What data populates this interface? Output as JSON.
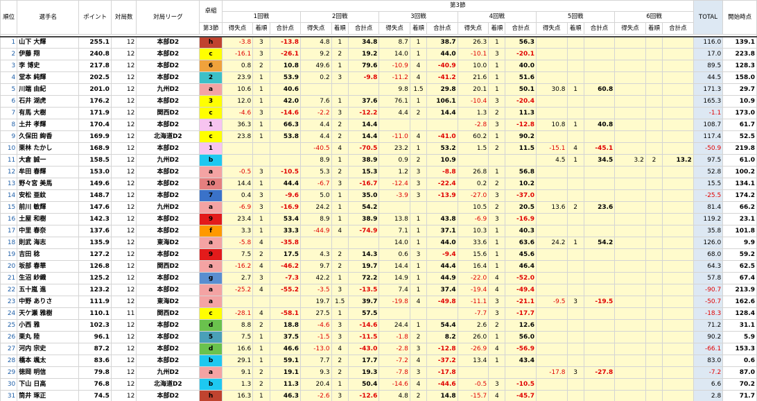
{
  "header": {
    "rank": "順位",
    "name": "選手名",
    "points": "ポイント",
    "games": "対局数",
    "league": "対局リーグ",
    "table_group": "卓組",
    "table_group_sub": "第3節",
    "section": "第3節",
    "rounds": [
      "1回戦",
      "2回戦",
      "3回戦",
      "4回戦",
      "5回戦",
      "6回戦"
    ],
    "sub": [
      "得失点",
      "着順",
      "合計点"
    ],
    "total": "TOTAL",
    "start": "開始時点"
  },
  "colors": {
    "h": "#c0432f",
    "c": "#ffff00",
    "6": "#f0a23c",
    "2": "#3cc0c8",
    "a": "#f4a3a3",
    "3": "#ffff00",
    "1": "#f7c4f0",
    "b": "#1ec8f0",
    "10": "#e57f7f",
    "7": "#3a72c9",
    "9": "#e31b1b",
    "f": "#ff9900",
    "g": "#5a8ed0",
    "d": "#6ac24d",
    "5": "#4aa0b8"
  },
  "rows": [
    {
      "rank": "1",
      "name": "山下 大輝",
      "pts": "255.1",
      "games": "12",
      "league": "本部D2",
      "tb": "h",
      "r": [
        [
          "-3.8",
          "3",
          "-13.8"
        ],
        [
          "4.8",
          "1",
          "34.8"
        ],
        [
          "8.7",
          "1",
          "38.7"
        ],
        [
          "26.3",
          "1",
          "56.3"
        ],
        [
          "",
          "",
          ""
        ],
        [
          "",
          "",
          ""
        ]
      ],
      "total": "116.0",
      "start": "139.1"
    },
    {
      "rank": "2",
      "name": "伊藤 翔",
      "pts": "240.8",
      "games": "12",
      "league": "本部D2",
      "tb": "c",
      "r": [
        [
          "-16.1",
          "3",
          "-26.1"
        ],
        [
          "9.2",
          "2",
          "19.2"
        ],
        [
          "14.0",
          "1",
          "44.0"
        ],
        [
          "-10.1",
          "3",
          "-20.1"
        ],
        [
          "",
          "",
          ""
        ],
        [
          "",
          "",
          ""
        ]
      ],
      "total": "17.0",
      "start": "223.8"
    },
    {
      "rank": "3",
      "name": "李 博史",
      "pts": "217.8",
      "games": "12",
      "league": "本部D2",
      "tb": "6",
      "r": [
        [
          "0.8",
          "2",
          "10.8"
        ],
        [
          "49.6",
          "1",
          "79.6"
        ],
        [
          "-10.9",
          "4",
          "-40.9"
        ],
        [
          "10.0",
          "1",
          "40.0"
        ],
        [
          "",
          "",
          ""
        ],
        [
          "",
          "",
          ""
        ]
      ],
      "total": "89.5",
      "start": "128.3"
    },
    {
      "rank": "4",
      "name": "堂本 純輝",
      "pts": "202.5",
      "games": "12",
      "league": "本部D2",
      "tb": "2",
      "r": [
        [
          "23.9",
          "1",
          "53.9"
        ],
        [
          "0.2",
          "3",
          "-9.8"
        ],
        [
          "-11.2",
          "4",
          "-41.2"
        ],
        [
          "21.6",
          "1",
          "51.6"
        ],
        [
          "",
          "",
          ""
        ],
        [
          "",
          "",
          ""
        ]
      ],
      "total": "44.5",
      "start": "158.0"
    },
    {
      "rank": "5",
      "name": "川端 由紀",
      "pts": "201.0",
      "games": "12",
      "league": "九州D2",
      "tb": "a",
      "r": [
        [
          "10.6",
          "1",
          "40.6"
        ],
        [
          "",
          "",
          ""
        ],
        [
          "9.8",
          "1.5",
          "29.8"
        ],
        [
          "20.1",
          "1",
          "50.1"
        ],
        [
          "30.8",
          "1",
          "60.8"
        ],
        [
          "",
          "",
          ""
        ]
      ],
      "total": "171.3",
      "start": "29.7"
    },
    {
      "rank": "6",
      "name": "石井 湖虎",
      "pts": "176.2",
      "games": "12",
      "league": "本部D2",
      "tb": "3",
      "r": [
        [
          "12.0",
          "1",
          "42.0"
        ],
        [
          "7.6",
          "1",
          "37.6"
        ],
        [
          "76.1",
          "1",
          "106.1"
        ],
        [
          "-10.4",
          "3",
          "-20.4"
        ],
        [
          "",
          "",
          ""
        ],
        [
          "",
          "",
          ""
        ]
      ],
      "total": "165.3",
      "start": "10.9"
    },
    {
      "rank": "7",
      "name": "有馬 大樹",
      "pts": "171.9",
      "games": "12",
      "league": "関西D2",
      "tb": "c",
      "r": [
        [
          "-4.6",
          "3",
          "-14.6"
        ],
        [
          "-2.2",
          "3",
          "-12.2"
        ],
        [
          "4.4",
          "2",
          "14.4"
        ],
        [
          "1.3",
          "2",
          "11.3"
        ],
        [
          "",
          "",
          ""
        ],
        [
          "",
          "",
          ""
        ]
      ],
      "total": "-1.1",
      "start": "173.0"
    },
    {
      "rank": "8",
      "name": "土井 孝輝",
      "pts": "170.4",
      "games": "12",
      "league": "本部D2",
      "tb": "1",
      "r": [
        [
          "36.3",
          "1",
          "66.3"
        ],
        [
          "4.4",
          "2",
          "14.4"
        ],
        [
          "",
          "",
          ""
        ],
        [
          "-2.8",
          "3",
          "-12.8"
        ],
        [
          "10.8",
          "1",
          "40.8"
        ],
        [
          "",
          "",
          ""
        ]
      ],
      "total": "108.7",
      "start": "61.7"
    },
    {
      "rank": "9",
      "name": "久保田 絢香",
      "pts": "169.9",
      "games": "12",
      "league": "北海道D2",
      "tb": "c",
      "r": [
        [
          "23.8",
          "1",
          "53.8"
        ],
        [
          "4.4",
          "2",
          "14.4"
        ],
        [
          "-11.0",
          "4",
          "-41.0"
        ],
        [
          "60.2",
          "1",
          "90.2"
        ],
        [
          "",
          "",
          ""
        ],
        [
          "",
          "",
          ""
        ]
      ],
      "total": "117.4",
      "start": "52.5"
    },
    {
      "rank": "10",
      "name": "栗林 たかし",
      "pts": "168.9",
      "games": "12",
      "league": "本部D2",
      "tb": "1",
      "r": [
        [
          "",
          "",
          ""
        ],
        [
          "-40.5",
          "4",
          "-70.5"
        ],
        [
          "23.2",
          "1",
          "53.2"
        ],
        [
          "1.5",
          "2",
          "11.5"
        ],
        [
          "-15.1",
          "4",
          "-45.1"
        ],
        [
          "",
          "",
          ""
        ]
      ],
      "total": "-50.9",
      "start": "219.8"
    },
    {
      "rank": "11",
      "name": "大倉 誠一",
      "pts": "158.5",
      "games": "12",
      "league": "九州D2",
      "tb": "b",
      "r": [
        [
          "",
          "",
          ""
        ],
        [
          "8.9",
          "1",
          "38.9"
        ],
        [
          "0.9",
          "2",
          "10.9"
        ],
        [
          "",
          "",
          ""
        ],
        [
          "4.5",
          "1",
          "34.5"
        ],
        [
          "3.2",
          "2",
          "13.2"
        ]
      ],
      "total": "97.5",
      "start": "61.0"
    },
    {
      "rank": "12",
      "name": "牟田 春輝",
      "pts": "153.0",
      "games": "12",
      "league": "本部D2",
      "tb": "a",
      "r": [
        [
          "-0.5",
          "3",
          "-10.5"
        ],
        [
          "5.3",
          "2",
          "15.3"
        ],
        [
          "1.2",
          "3",
          "-8.8"
        ],
        [
          "26.8",
          "1",
          "56.8"
        ],
        [
          "",
          "",
          ""
        ],
        [
          "",
          "",
          ""
        ]
      ],
      "total": "52.8",
      "start": "100.2"
    },
    {
      "rank": "13",
      "name": "野々宮 美馬",
      "pts": "149.6",
      "games": "12",
      "league": "本部D2",
      "tb": "10",
      "r": [
        [
          "14.4",
          "1",
          "44.4"
        ],
        [
          "-6.7",
          "3",
          "-16.7"
        ],
        [
          "-12.4",
          "3",
          "-22.4"
        ],
        [
          "0.2",
          "2",
          "10.2"
        ],
        [
          "",
          "",
          ""
        ],
        [
          "",
          "",
          ""
        ]
      ],
      "total": "15.5",
      "start": "134.1"
    },
    {
      "rank": "14",
      "name": "安松 亜紋",
      "pts": "148.7",
      "games": "12",
      "league": "本部D2",
      "tb": "7",
      "r": [
        [
          "0.4",
          "3",
          "-9.6"
        ],
        [
          "5.0",
          "1",
          "35.0"
        ],
        [
          "-3.9",
          "3",
          "-13.9"
        ],
        [
          "-27.0",
          "3",
          "-37.0"
        ],
        [
          "",
          "",
          ""
        ],
        [
          "",
          "",
          ""
        ]
      ],
      "total": "-25.5",
      "start": "174.2"
    },
    {
      "rank": "15",
      "name": "前川 敏輝",
      "pts": "147.6",
      "games": "12",
      "league": "九州D2",
      "tb": "a",
      "r": [
        [
          "-6.9",
          "3",
          "-16.9"
        ],
        [
          "24.2",
          "1",
          "54.2"
        ],
        [
          "",
          "",
          ""
        ],
        [
          "10.5",
          "2",
          "20.5"
        ],
        [
          "13.6",
          "2",
          "23.6"
        ],
        [
          "",
          "",
          ""
        ]
      ],
      "total": "81.4",
      "start": "66.2"
    },
    {
      "rank": "16",
      "name": "土屋 和樹",
      "pts": "142.3",
      "games": "12",
      "league": "本部D2",
      "tb": "9",
      "r": [
        [
          "23.4",
          "1",
          "53.4"
        ],
        [
          "8.9",
          "1",
          "38.9"
        ],
        [
          "13.8",
          "1",
          "43.8"
        ],
        [
          "-6.9",
          "3",
          "-16.9"
        ],
        [
          "",
          "",
          ""
        ],
        [
          "",
          "",
          ""
        ]
      ],
      "total": "119.2",
      "start": "23.1"
    },
    {
      "rank": "17",
      "name": "中里 春奈",
      "pts": "137.6",
      "games": "12",
      "league": "本部D2",
      "tb": "f",
      "r": [
        [
          "3.3",
          "1",
          "33.3"
        ],
        [
          "-44.9",
          "4",
          "-74.9"
        ],
        [
          "7.1",
          "1",
          "37.1"
        ],
        [
          "10.3",
          "1",
          "40.3"
        ],
        [
          "",
          "",
          ""
        ],
        [
          "",
          "",
          ""
        ]
      ],
      "total": "35.8",
      "start": "101.8"
    },
    {
      "rank": "18",
      "name": "則武 海志",
      "pts": "135.9",
      "games": "12",
      "league": "東海D2",
      "tb": "a",
      "r": [
        [
          "-5.8",
          "4",
          "-35.8"
        ],
        [
          "",
          "",
          ""
        ],
        [
          "14.0",
          "1",
          "44.0"
        ],
        [
          "33.6",
          "1",
          "63.6"
        ],
        [
          "24.2",
          "1",
          "54.2"
        ],
        [
          "",
          "",
          ""
        ]
      ],
      "total": "126.0",
      "start": "9.9"
    },
    {
      "rank": "19",
      "name": "吉田 稔",
      "pts": "127.2",
      "games": "12",
      "league": "本部D2",
      "tb": "9",
      "r": [
        [
          "7.5",
          "2",
          "17.5"
        ],
        [
          "4.3",
          "2",
          "14.3"
        ],
        [
          "0.6",
          "3",
          "-9.4"
        ],
        [
          "15.6",
          "1",
          "45.6"
        ],
        [
          "",
          "",
          ""
        ],
        [
          "",
          "",
          ""
        ]
      ],
      "total": "68.0",
      "start": "59.2"
    },
    {
      "rank": "20",
      "name": "坂部 春華",
      "pts": "126.8",
      "games": "12",
      "league": "関西D2",
      "tb": "a",
      "r": [
        [
          "-16.2",
          "4",
          "-46.2"
        ],
        [
          "9.7",
          "2",
          "19.7"
        ],
        [
          "14.4",
          "1",
          "44.4"
        ],
        [
          "16.4",
          "1",
          "46.4"
        ],
        [
          "",
          "",
          ""
        ],
        [
          "",
          "",
          ""
        ]
      ],
      "total": "64.3",
      "start": "62.5"
    },
    {
      "rank": "21",
      "name": "生沼 紗織",
      "pts": "125.2",
      "games": "12",
      "league": "本部D2",
      "tb": "g",
      "r": [
        [
          "2.7",
          "3",
          "-7.3"
        ],
        [
          "42.2",
          "1",
          "72.2"
        ],
        [
          "14.9",
          "1",
          "44.9"
        ],
        [
          "-22.0",
          "4",
          "-52.0"
        ],
        [
          "",
          "",
          ""
        ],
        [
          "",
          "",
          ""
        ]
      ],
      "total": "57.8",
      "start": "67.4"
    },
    {
      "rank": "22",
      "name": "五十嵐 進",
      "pts": "123.2",
      "games": "12",
      "league": "本部D2",
      "tb": "a",
      "r": [
        [
          "-25.2",
          "4",
          "-55.2"
        ],
        [
          "-3.5",
          "3",
          "-13.5"
        ],
        [
          "7.4",
          "1",
          "37.4"
        ],
        [
          "-19.4",
          "4",
          "-49.4"
        ],
        [
          "",
          "",
          ""
        ],
        [
          "",
          "",
          ""
        ]
      ],
      "total": "-90.7",
      "start": "213.9"
    },
    {
      "rank": "23",
      "name": "中野 ありさ",
      "pts": "111.9",
      "games": "12",
      "league": "東海D2",
      "tb": "a",
      "r": [
        [
          "",
          "",
          ""
        ],
        [
          "19.7",
          "1.5",
          "39.7"
        ],
        [
          "-19.8",
          "4",
          "-49.8"
        ],
        [
          "-11.1",
          "3",
          "-21.1"
        ],
        [
          "-9.5",
          "3",
          "-19.5"
        ],
        [
          "",
          "",
          ""
        ]
      ],
      "total": "-50.7",
      "start": "162.6"
    },
    {
      "rank": "24",
      "name": "天ケ瀬 雅樹",
      "pts": "110.1",
      "games": "11",
      "league": "関西D2",
      "tb": "c",
      "r": [
        [
          "-28.1",
          "4",
          "-58.1"
        ],
        [
          "27.5",
          "1",
          "57.5"
        ],
        [
          "",
          "",
          ""
        ],
        [
          "-7.7",
          "3",
          "-17.7"
        ],
        [
          "",
          "",
          ""
        ],
        [
          "",
          "",
          ""
        ]
      ],
      "total": "-18.3",
      "start": "128.4"
    },
    {
      "rank": "25",
      "name": "小西 雅",
      "pts": "102.3",
      "games": "12",
      "league": "本部D2",
      "tb": "d",
      "r": [
        [
          "8.8",
          "2",
          "18.8"
        ],
        [
          "-4.6",
          "3",
          "-14.6"
        ],
        [
          "24.4",
          "1",
          "54.4"
        ],
        [
          "2.6",
          "2",
          "12.6"
        ],
        [
          "",
          "",
          ""
        ],
        [
          "",
          "",
          ""
        ]
      ],
      "total": "71.2",
      "start": "31.1"
    },
    {
      "rank": "26",
      "name": "栗丸 陸",
      "pts": "96.1",
      "games": "12",
      "league": "本部D2",
      "tb": "5",
      "r": [
        [
          "7.5",
          "1",
          "37.5"
        ],
        [
          "-1.5",
          "3",
          "-11.5"
        ],
        [
          "-1.8",
          "2",
          "8.2"
        ],
        [
          "26.0",
          "1",
          "56.0"
        ],
        [
          "",
          "",
          ""
        ],
        [
          "",
          "",
          ""
        ]
      ],
      "total": "90.2",
      "start": "5.9"
    },
    {
      "rank": "27",
      "name": "河内 宗史",
      "pts": "87.2",
      "games": "12",
      "league": "本部D2",
      "tb": "d",
      "r": [
        [
          "16.6",
          "1",
          "46.6"
        ],
        [
          "-13.0",
          "4",
          "-43.0"
        ],
        [
          "-2.8",
          "3",
          "-12.8"
        ],
        [
          "-26.9",
          "4",
          "-56.9"
        ],
        [
          "",
          "",
          ""
        ],
        [
          "",
          "",
          ""
        ]
      ],
      "total": "-66.1",
      "start": "153.3"
    },
    {
      "rank": "28",
      "name": "橋本 颯太",
      "pts": "83.6",
      "games": "12",
      "league": "本部D2",
      "tb": "b",
      "r": [
        [
          "29.1",
          "1",
          "59.1"
        ],
        [
          "7.7",
          "2",
          "17.7"
        ],
        [
          "-7.2",
          "4",
          "-37.2"
        ],
        [
          "13.4",
          "1",
          "43.4"
        ],
        [
          "",
          "",
          ""
        ],
        [
          "",
          "",
          ""
        ]
      ],
      "total": "83.0",
      "start": "0.6"
    },
    {
      "rank": "29",
      "name": "徳岡 明信",
      "pts": "79.8",
      "games": "12",
      "league": "九州D2",
      "tb": "a",
      "r": [
        [
          "9.1",
          "2",
          "19.1"
        ],
        [
          "9.3",
          "2",
          "19.3"
        ],
        [
          "-7.8",
          "3",
          "-17.8"
        ],
        [
          "",
          "",
          ""
        ],
        [
          "-17.8",
          "3",
          "-27.8"
        ],
        [
          "",
          "",
          ""
        ]
      ],
      "total": "-7.2",
      "start": "87.0"
    },
    {
      "rank": "30",
      "name": "下山 日高",
      "pts": "76.8",
      "games": "12",
      "league": "北海道D2",
      "tb": "b",
      "r": [
        [
          "1.3",
          "2",
          "11.3"
        ],
        [
          "20.4",
          "1",
          "50.4"
        ],
        [
          "-14.6",
          "4",
          "-44.6"
        ],
        [
          "-0.5",
          "3",
          "-10.5"
        ],
        [
          "",
          "",
          ""
        ],
        [
          "",
          "",
          ""
        ]
      ],
      "total": "6.6",
      "start": "70.2"
    },
    {
      "rank": "31",
      "name": "筒井 琢正",
      "pts": "74.5",
      "games": "12",
      "league": "本部D2",
      "tb": "h",
      "r": [
        [
          "16.3",
          "1",
          "46.3"
        ],
        [
          "-2.6",
          "3",
          "-12.6"
        ],
        [
          "4.8",
          "2",
          "14.8"
        ],
        [
          "-15.7",
          "4",
          "-45.7"
        ],
        [
          "",
          "",
          ""
        ],
        [
          "",
          "",
          ""
        ]
      ],
      "total": "2.8",
      "start": "71.7"
    }
  ]
}
